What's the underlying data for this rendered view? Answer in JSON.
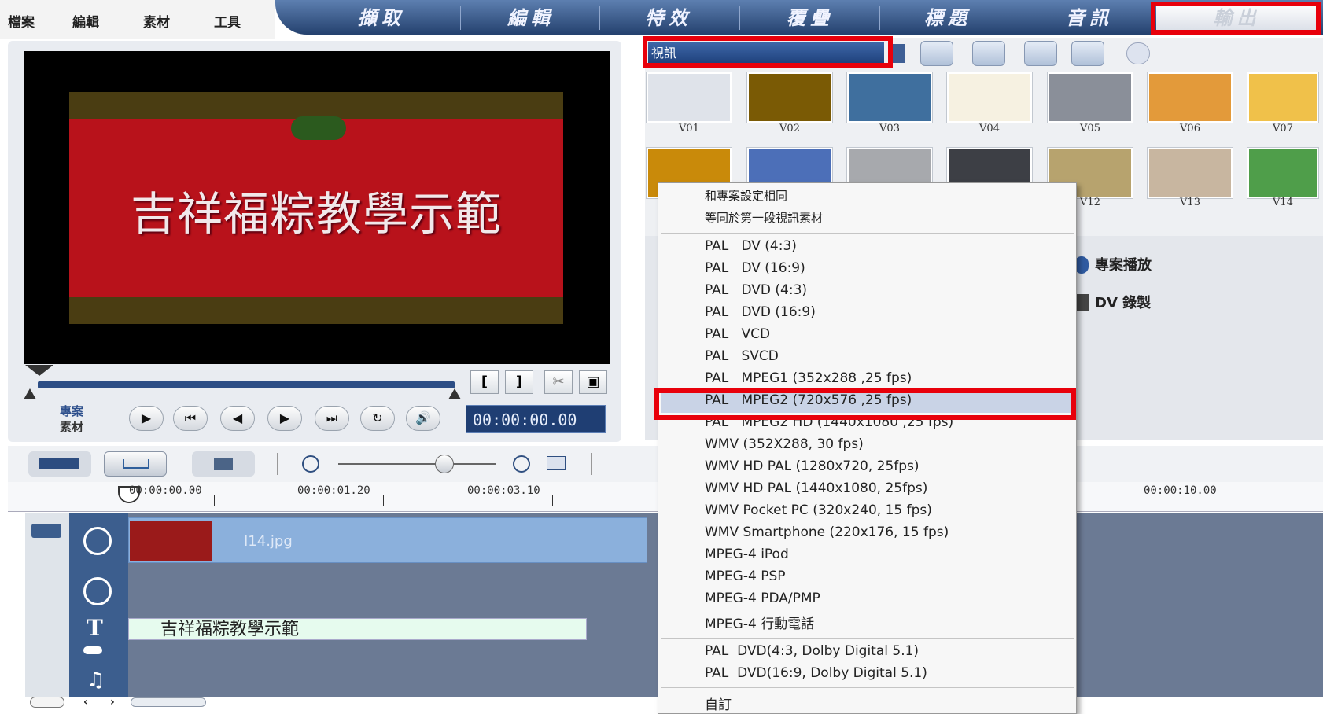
{
  "menu": [
    "檔案",
    "編輯",
    "素材",
    "工具"
  ],
  "steps": [
    "擷取",
    "編輯",
    "特效",
    "覆疊",
    "標題",
    "音訊",
    "輸出"
  ],
  "preview": {
    "title_text": "吉祥福粽教學示範",
    "mode_project": "專案",
    "mode_clip": "素材",
    "timecode": "00:00:00.00"
  },
  "library": {
    "category": "視訊",
    "thumbnails": [
      "V01",
      "V02",
      "V03",
      "V04",
      "V05",
      "V06",
      "V07",
      "V12",
      "V13",
      "V14"
    ],
    "options": [
      "專案播放",
      "DV 錄製"
    ]
  },
  "timeline": {
    "ruler": [
      "00:00:00.00",
      "00:00:01.20",
      "00:00:03.10",
      "00:00:10.00"
    ],
    "clip_name": "I14.jpg",
    "title_clip": "吉祥福粽教學示範"
  },
  "dropdown": {
    "top_items": [
      "和專案設定相同",
      "等同於第一段視訊素材"
    ],
    "items": [
      "PAL   DV (4:3)",
      "PAL   DV (16:9)",
      "PAL   DVD (4:3)",
      "PAL   DVD (16:9)",
      "PAL   VCD",
      "PAL   SVCD",
      "PAL   MPEG1 (352x288 ,25 fps)",
      "PAL   MPEG2 (720x576 ,25 fps)",
      "PAL   MPEG2 HD (1440x1080 ,25 fps)",
      "WMV (352X288, 30 fps)",
      "WMV HD PAL (1280x720, 25fps)",
      "WMV HD PAL (1440x1080, 25fps)",
      "WMV Pocket PC (320x240, 15 fps)",
      "WMV Smartphone (220x176, 15 fps)",
      "MPEG-4 iPod",
      "MPEG-4 PSP",
      "MPEG-4 PDA/PMP",
      "MPEG-4 行動電話"
    ],
    "dolby_items": [
      "PAL  DVD(4:3, Dolby Digital 5.1)",
      "PAL  DVD(16:9, Dolby Digital 5.1)"
    ],
    "custom": "自訂",
    "selected": "PAL   MPEG2 (720x576 ,25 fps)"
  },
  "colors": {
    "highlight": "#e8000b",
    "tab_bar": "#24416e",
    "track": "#6b7a94"
  }
}
